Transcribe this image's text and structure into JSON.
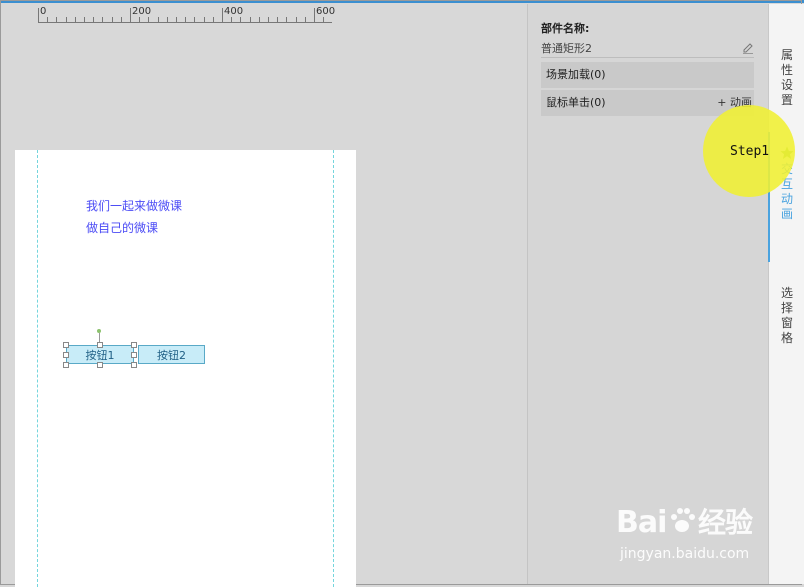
{
  "ruler": {
    "labels": [
      "0",
      "200",
      "400",
      "600"
    ]
  },
  "canvas": {
    "text_line1": "我们一起来做微课",
    "text_line2": "做自己的微课",
    "button1_label": "按钮1",
    "button2_label": "按钮2"
  },
  "properties": {
    "component_name_label": "部件名称:",
    "component_name_value": "普通矩形2",
    "events": [
      {
        "label": "场景加载(0)",
        "action": ""
      },
      {
        "label": "鼠标单击(0)",
        "action": "+ 动画"
      }
    ]
  },
  "tabs": [
    {
      "label": "属性设置",
      "chars": [
        "属",
        "性",
        "设",
        "置"
      ],
      "active": false
    },
    {
      "label": "交互动画",
      "chars": [
        "交",
        "互",
        "动",
        "画"
      ],
      "active": true
    },
    {
      "label": "选择窗格",
      "chars": [
        "选",
        "择",
        "窗",
        "格"
      ],
      "active": false
    }
  ],
  "highlight": {
    "text": "Step1"
  },
  "watermark": {
    "logo": "Bai🐾经验",
    "url": "jingyan.baidu.com"
  },
  "colors": {
    "accent": "#4aa3df",
    "canvas_text": "#4b4bf5",
    "button_fill": "#c8ecf8",
    "highlight": "#f0f032"
  }
}
